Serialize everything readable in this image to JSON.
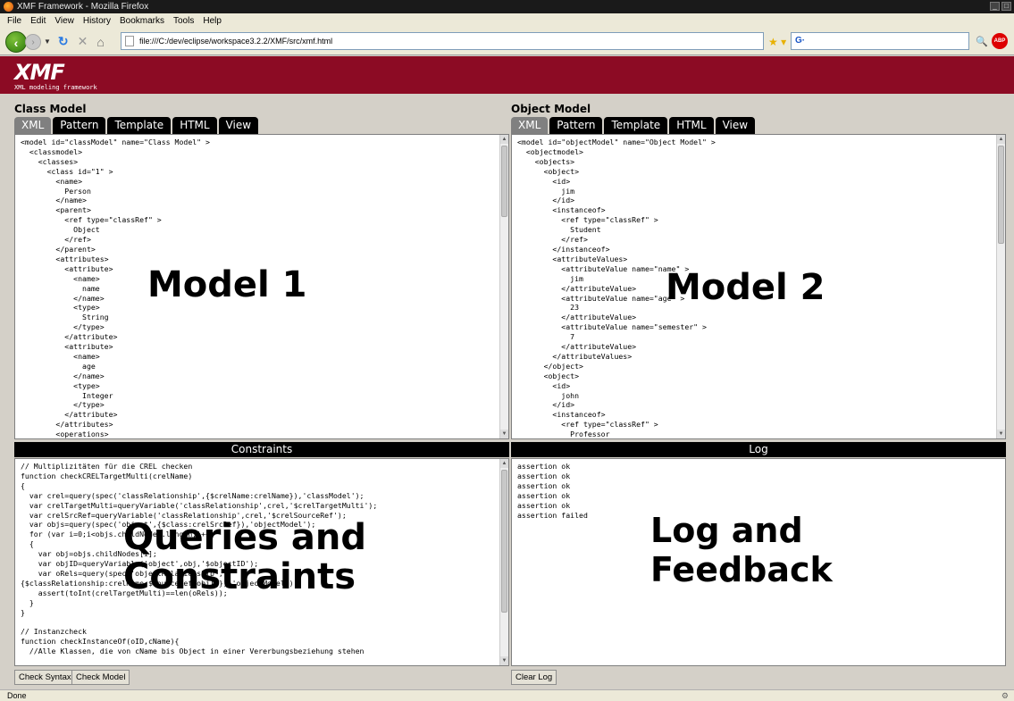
{
  "window": {
    "title": "XMF Framework - Mozilla Firefox"
  },
  "menu": [
    "File",
    "Edit",
    "View",
    "History",
    "Bookmarks",
    "Tools",
    "Help"
  ],
  "nav": {
    "url": "file:///C:/dev/eclipse/workspace3.2.2/XMF/src/xmf.html",
    "search_engine_label": "G·"
  },
  "banner": {
    "logo": "XMF",
    "tagline": "XML modeling framework"
  },
  "class_model": {
    "title": "Class Model",
    "tabs": [
      "XML",
      "Pattern",
      "Template",
      "HTML",
      "View"
    ],
    "code": "<model id=\"classModel\" name=\"Class Model\" >\n  <classmodel>\n    <classes>\n      <class id=\"1\" >\n        <name>\n          Person\n        </name>\n        <parent>\n          <ref type=\"classRef\" >\n            Object\n          </ref>\n        </parent>\n        <attributes>\n          <attribute>\n            <name>\n              name\n            </name>\n            <type>\n              String\n            </type>\n          </attribute>\n          <attribute>\n            <name>\n              age\n            </name>\n            <type>\n              Integer\n            </type>\n          </attribute>\n        </attributes>\n        <operations>",
    "overlay": "Model 1"
  },
  "object_model": {
    "title": "Object Model",
    "tabs": [
      "XML",
      "Pattern",
      "Template",
      "HTML",
      "View"
    ],
    "code": "<model id=\"objectModel\" name=\"Object Model\" >\n  <objectmodel>\n    <objects>\n      <object>\n        <id>\n          jim\n        </id>\n        <instanceof>\n          <ref type=\"classRef\" >\n            Student\n          </ref>\n        </instanceof>\n        <attributeValues>\n          <attributeValue name=\"name\" >\n            jim\n          </attributeValue>\n          <attributeValue name=\"age\" >\n            23\n          </attributeValue>\n          <attributeValue name=\"semester\" >\n            7\n          </attributeValue>\n        </attributeValues>\n      </object>\n      <object>\n        <id>\n          john\n        </id>\n        <instanceof>\n          <ref type=\"classRef\" >\n            Professor",
    "overlay": "Model 2"
  },
  "constraints": {
    "title": "Constraints",
    "code": "// Multiplizitäten für die CREL checken\nfunction checkCRELTargetMulti(crelName)\n{\n  var crel=query(spec('classRelationship',{$crelName:crelName}),'classModel');\n  var crelTargetMulti=queryVariable('classRelationship',crel,'$crelTargetMulti');\n  var crelSrcRef=queryVariable('classRelationship',crel,'$crelSourceRef');\n  var objs=query(spec('object',{$class:crelSrcRef}),'objectModel');\n  for (var i=0;i<objs.childNodes.length;i++)\n  {\n    var obj=objs.childNodes[i];\n    var objID=queryVariable('object',obj,'$objectID');\n    var oRels=query(spec('objectRelationship',\n{$classRelationship:crelName,$sourceRef:objID}),'objectModel');\n    assert(toInt(crelTargetMulti)==len(oRels));\n  }\n}\n\n// Instanzcheck\nfunction checkInstanceOf(oID,cName){\n  //Alle Klassen, die von cName bis Object in einer Vererbungsbeziehung stehen",
    "overlay_line1": "Queries and",
    "overlay_line2": "Constraints",
    "buttons": {
      "check_syntax": "Check Syntax",
      "check_model": "Check Model"
    }
  },
  "log": {
    "title": "Log",
    "entries": [
      "assertion ok",
      "assertion ok",
      "assertion ok",
      "assertion ok",
      "assertion ok",
      "assertion failed"
    ],
    "overlay_line1": "Log and",
    "overlay_line2": "Feedback",
    "clear_label": "Clear Log"
  },
  "status": {
    "text": "Done"
  }
}
